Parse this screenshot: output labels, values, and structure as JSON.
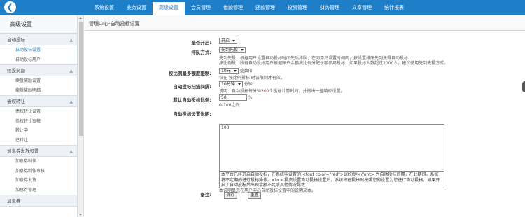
{
  "colors": {
    "topbar": "#1f7ec8",
    "accent": "#1f7ec8",
    "highlight": "#e0261b"
  },
  "topbar": {
    "back_icon": "left-arrow-icon",
    "tabs": [
      {
        "label": "系统设置"
      },
      {
        "label": "业务设置"
      },
      {
        "label": "高级设置",
        "active": true
      },
      {
        "label": "会员管理"
      },
      {
        "label": "借款管理"
      },
      {
        "label": "还款管理"
      },
      {
        "label": "投资管理"
      },
      {
        "label": "财务管理"
      },
      {
        "label": "文章管理"
      },
      {
        "label": "统计报表"
      }
    ]
  },
  "sidebar": {
    "title": "高级设置",
    "groups": [
      {
        "label": "自动投标",
        "items": [
          "自动投标设置",
          "自动投标用户"
        ]
      },
      {
        "label": "续投奖励",
        "items": [
          "续投奖励设置",
          "续投奖励明细"
        ]
      },
      {
        "label": "债权转让",
        "items": [
          "债权转让设置",
          "债权转让审核",
          "转让中",
          "已转让"
        ]
      },
      {
        "label": "加息券发放设置",
        "items": [
          "加息券制作",
          "加息券制作审核",
          "加息券发放",
          "加息券管理"
        ]
      },
      {
        "label": "加息券"
      }
    ]
  },
  "main": {
    "breadcrumb": "管理中心-自动投标设置",
    "fields": {
      "enable": {
        "label": "是否开启:",
        "value": "开启"
      },
      "order": {
        "label": "排队方式:",
        "value": "先到先投",
        "desc1": "先到先投：根据用户设置自动投标时间先后排队；在同用户设置时间内，按设置排序先到先得自动投标。",
        "desc2": "按比例投：所有自动投标用户根据账户余额按比例分配份额参与投标，如果投标人数超过2000人，建议使用先到先投方式。"
      },
      "max_amount": {
        "label": "按比例最多额度限制:",
        "value": "10元",
        "suffix": "整数倍",
        "note": "仅在 按比例投标 时该限制才有效。"
      },
      "interval": {
        "label": "自动投标扫描间隔:",
        "value": "10分钟",
        "suffix": "分钟",
        "note_pre": "说明：自动投标每分钟",
        "note_num": "300",
        "note_post": "个投标计算时间，并做出一些响应设置。"
      },
      "ratio": {
        "label": "默认自动投标比例:",
        "value": "50",
        "suffix": "%",
        "note": "0-100之间"
      },
      "desc": {
        "label": "自动投标设置说明:",
        "value": "100",
        "note": "本说明显示在用户中心自动投标设置中的说明文本。"
      },
      "remark": {
        "label": "备注:",
        "value": "本平台已经开启自动投标，在系统中设置的 <font color=\"red\">10分钟</font> 为自动投标间隔，在此期间，系统将不定期的进行投标操作。<br>\n投资设置自动投标设置后，系统将在投标时按照您的设置为您进行自动投标。如果开启了自动投标后出现余额不足或其他情况导致"
      }
    },
    "buttons": {
      "save": "保存",
      "reset": "重置"
    }
  }
}
